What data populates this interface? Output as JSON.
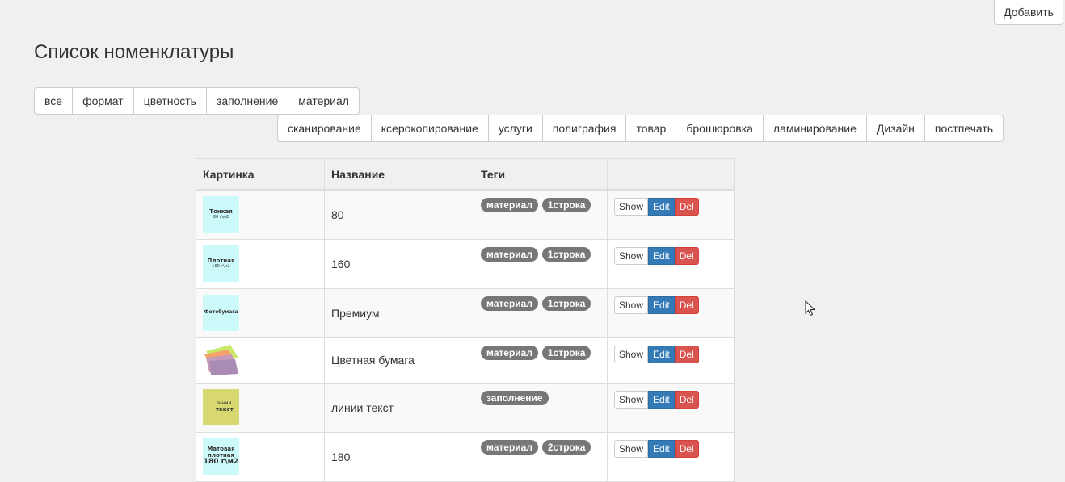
{
  "header": {
    "add_label": "Добавить",
    "title": "Список номенклатуры"
  },
  "filters_primary": [
    "все",
    "формат",
    "цветность",
    "заполнение",
    "материал"
  ],
  "filters_secondary": [
    "сканирование",
    "ксерокопирование",
    "услуги",
    "полиграфия",
    "товар",
    "брошюровка",
    "ламинирование",
    "Дизайн",
    "постпечать"
  ],
  "table": {
    "columns": [
      "Картинка",
      "Название",
      "Теги",
      ""
    ],
    "rows": [
      {
        "thumb": {
          "line1": "Тонкая",
          "line2": "80 г\\м2",
          "color": "#ccfafa"
        },
        "name": "80",
        "tags": [
          "материал",
          "1строка"
        ]
      },
      {
        "thumb": {
          "line1": "Плотная",
          "line2": "160 г\\м2",
          "color": "#ccfafa"
        },
        "name": "160",
        "tags": [
          "материал",
          "1строка"
        ]
      },
      {
        "thumb": {
          "line1": "Фотобумага",
          "line2": "",
          "color": "#ccfafa"
        },
        "name": "Премиум",
        "tags": [
          "материал",
          "1строка"
        ]
      },
      {
        "thumb": {
          "line1": "",
          "line2": "",
          "color": "#ffffff"
        },
        "name": "Цветная бумага",
        "tags": [
          "материал",
          "1строка"
        ]
      },
      {
        "thumb": {
          "line1": "линии",
          "line2": "текст",
          "color": "#d8d870"
        },
        "name": "линии текст",
        "tags": [
          "заполнение"
        ]
      },
      {
        "thumb": {
          "line1": "Матовая плотная",
          "line2": "180 г\\м2",
          "color": "#ccfafa"
        },
        "name": "180",
        "tags": [
          "материал",
          "2строка"
        ]
      }
    ],
    "actions": {
      "show": "Show",
      "edit": "Edit",
      "del": "Del"
    }
  },
  "colors": {
    "primary": "#337ab7",
    "danger": "#d9534f",
    "badge": "#777777",
    "background": "#f0f0f0"
  }
}
